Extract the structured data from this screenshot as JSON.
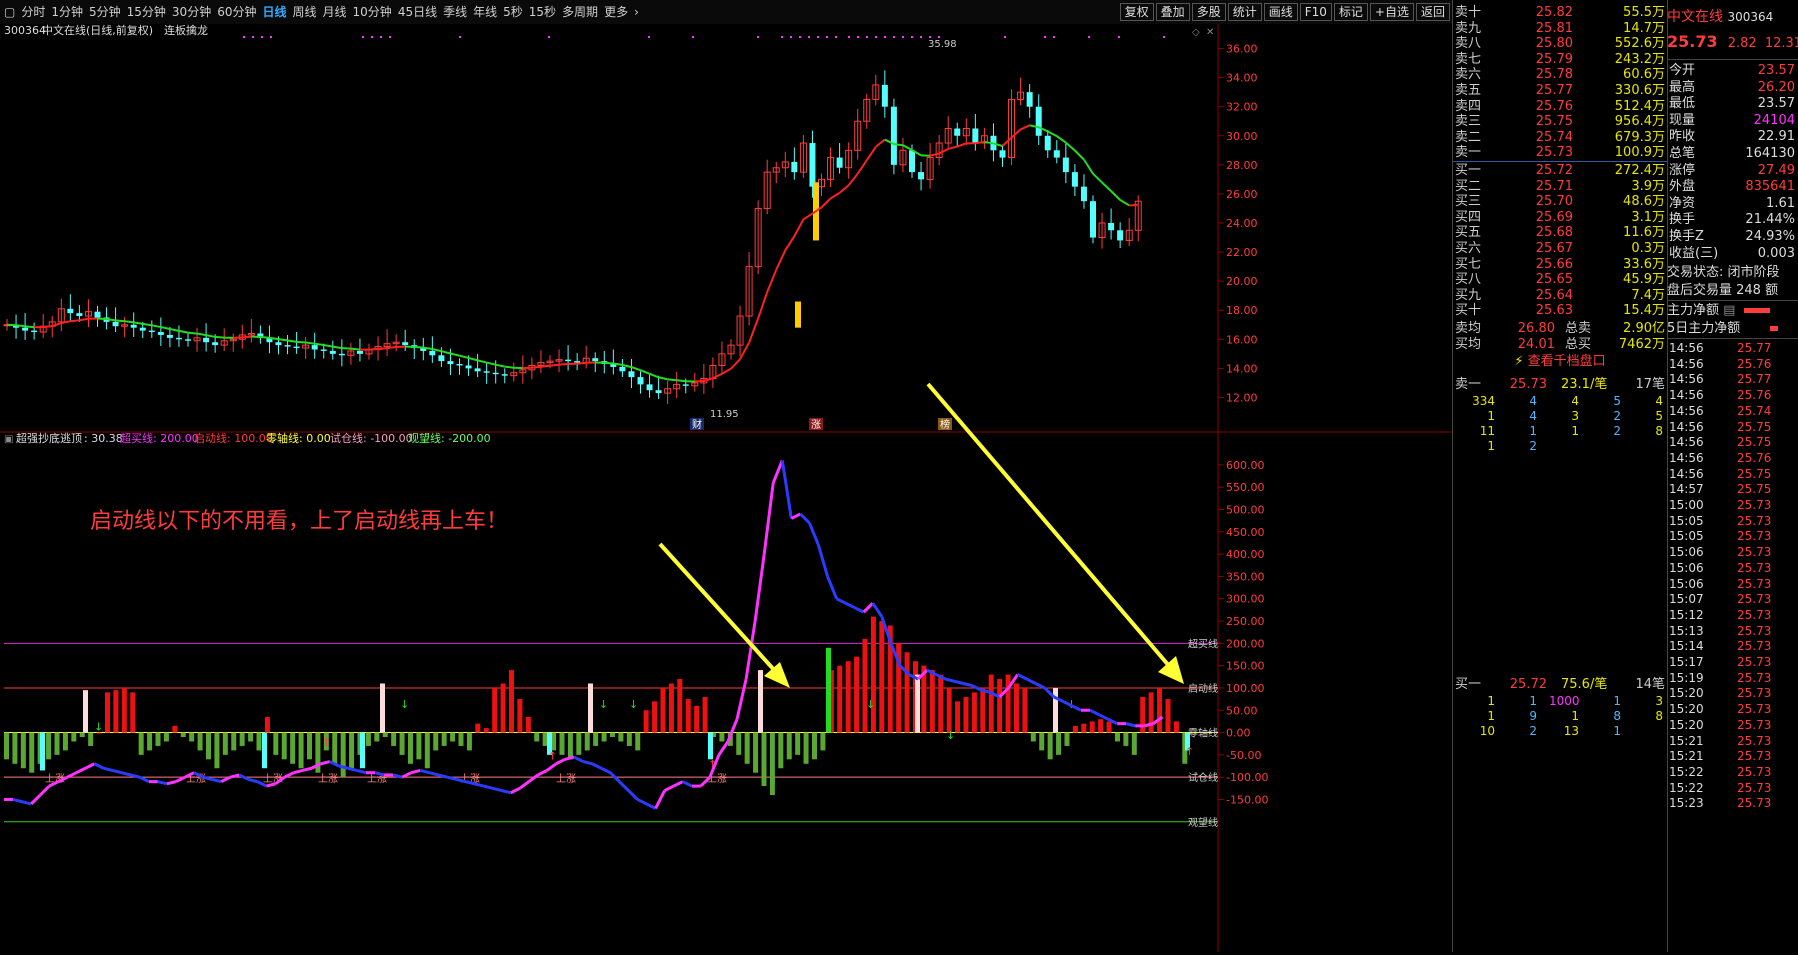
{
  "toolbar": {
    "periods": [
      "分时",
      "1分钟",
      "5分钟",
      "15分钟",
      "30分钟",
      "60分钟",
      "日线",
      "周线",
      "月线",
      "10分钟",
      "45日线",
      "季线",
      "年线",
      "5秒",
      "15秒",
      "多周期",
      "更多"
    ],
    "active_index": 6,
    "right_buttons": [
      "复权",
      "叠加",
      "多股",
      "统计",
      "画线",
      "F10",
      "标记",
      "+自选",
      "返回"
    ]
  },
  "chart_header": {
    "code": "300364",
    "name": "中文在线(日线,前复权)",
    "tag": "连板擒龙"
  },
  "price_axis": [
    "36.00",
    "34.00",
    "32.00",
    "30.00",
    "28.00",
    "26.00",
    "24.00",
    "22.00",
    "20.00",
    "18.00",
    "16.00",
    "14.00",
    "12.00"
  ],
  "price_labels": {
    "high": "35.98",
    "low": "11.95",
    "mark1": "财",
    "mark2": "涨",
    "mark3": "榜"
  },
  "indicator_header": {
    "name": "超强抄底逃顶",
    "value": ": 30.38",
    "chaomai": "超买线: 200.00",
    "qidong": "启动线: 100.00",
    "lingzhou": "零轴线: 0.00",
    "shicang": "试仓线: -100.00",
    "guanwang": "观望线: -200.00"
  },
  "indicator_axis": [
    "600.00",
    "550.00",
    "500.00",
    "450.00",
    "400.00",
    "350.00",
    "300.00",
    "250.00",
    "200.00",
    "150.00",
    "100.00",
    "50.00",
    "0.00",
    "-50.00",
    "-100.00",
    "-150.00"
  ],
  "indicator_lines": {
    "chaomai": "超买线",
    "qidong": "启动线",
    "lingzhou": "零轴线",
    "shicang": "试仓线",
    "guanwang": "观望线"
  },
  "annotation": "启动线以下的不用看，上了启动线再上车！",
  "bar_labels": [
    "上涨",
    "上涨",
    "上涨",
    "上涨",
    "上涨",
    "上涨",
    "上涨",
    "上涨"
  ],
  "sell_quotes": [
    {
      "label": "卖十",
      "price": "25.82",
      "vol": "55.5万"
    },
    {
      "label": "卖九",
      "price": "25.81",
      "vol": "14.7万"
    },
    {
      "label": "卖八",
      "price": "25.80",
      "vol": "552.6万"
    },
    {
      "label": "卖七",
      "price": "25.79",
      "vol": "243.2万"
    },
    {
      "label": "卖六",
      "price": "25.78",
      "vol": "60.6万"
    },
    {
      "label": "卖五",
      "price": "25.77",
      "vol": "330.6万"
    },
    {
      "label": "卖四",
      "price": "25.76",
      "vol": "512.4万"
    },
    {
      "label": "卖三",
      "price": "25.75",
      "vol": "956.4万"
    },
    {
      "label": "卖二",
      "price": "25.74",
      "vol": "679.3万"
    },
    {
      "label": "卖一",
      "price": "25.73",
      "vol": "100.9万"
    }
  ],
  "buy_quotes": [
    {
      "label": "买一",
      "price": "25.72",
      "vol": "272.4万"
    },
    {
      "label": "买二",
      "price": "25.71",
      "vol": "3.9万"
    },
    {
      "label": "买三",
      "price": "25.70",
      "vol": "48.6万"
    },
    {
      "label": "买四",
      "price": "25.69",
      "vol": "3.1万"
    },
    {
      "label": "买五",
      "price": "25.68",
      "vol": "11.6万"
    },
    {
      "label": "买六",
      "price": "25.67",
      "vol": "0.3万"
    },
    {
      "label": "买七",
      "price": "25.66",
      "vol": "33.6万"
    },
    {
      "label": "买八",
      "price": "25.65",
      "vol": "45.9万"
    },
    {
      "label": "买九",
      "price": "25.64",
      "vol": "7.4万"
    },
    {
      "label": "买十",
      "price": "25.63",
      "vol": "15.4万"
    }
  ],
  "averages": [
    {
      "label": "卖均",
      "price": "26.80",
      "k": "总卖",
      "v": "2.90亿"
    },
    {
      "label": "买均",
      "price": "24.01",
      "k": "总买",
      "v": "7462万"
    }
  ],
  "view_qiandang": "查看千档盘口",
  "sell1_queue": {
    "label": "卖一",
    "price": "25.73",
    "vol": "23.1/笔",
    "count": "17笔",
    "rows": [
      [
        "334",
        "4",
        "4",
        "5",
        "4"
      ],
      [
        "1",
        "4",
        "3",
        "2",
        "5"
      ],
      [
        "11",
        "1",
        "1",
        "2",
        "8"
      ],
      [
        "1",
        "2",
        "",
        "",
        ""
      ]
    ]
  },
  "buy1_queue": {
    "label": "买一",
    "price": "25.72",
    "vol": "75.6/笔",
    "count": "14笔",
    "rows": [
      [
        "1",
        "1",
        "1000",
        "1",
        "3"
      ],
      [
        "1",
        "9",
        "1",
        "8",
        "8"
      ],
      [
        "10",
        "2",
        "13",
        "1",
        ""
      ]
    ]
  },
  "stock": {
    "name": "中文在线",
    "code": "300364",
    "price": "25.73",
    "change": "2.82",
    "pct": "12.31"
  },
  "stats": [
    {
      "k": "今开",
      "v": "23.57"
    },
    {
      "k": "最高",
      "v": "26.20"
    },
    {
      "k": "最低",
      "v": "23.57"
    },
    {
      "k": "现量",
      "v": "24104"
    },
    {
      "k": "昨收",
      "v": "22.91"
    },
    {
      "k": "总笔",
      "v": "164130"
    },
    {
      "k": "涨停",
      "v": "27.49"
    },
    {
      "k": "外盘",
      "v": "835641"
    },
    {
      "k": "净资",
      "v": "1.61"
    },
    {
      "k": "换手",
      "v": "21.44%"
    },
    {
      "k": "换手Z",
      "v": "24.93%"
    },
    {
      "k": "收益(三)",
      "v": "0.003"
    }
  ],
  "trade_state": "交易状态: 闭市阶段",
  "auction_vol": "盘后交易量 248 额",
  "main_flow": "主力净额",
  "main_flow5": "5日主力净额",
  "ticks": [
    [
      "14:56",
      "25.77"
    ],
    [
      "14:56",
      "25.76"
    ],
    [
      "14:56",
      "25.77"
    ],
    [
      "14:56",
      "25.76"
    ],
    [
      "14:56",
      "25.74"
    ],
    [
      "14:56",
      "25.75"
    ],
    [
      "14:56",
      "25.75"
    ],
    [
      "14:56",
      "25.76"
    ],
    [
      "14:56",
      "25.75"
    ],
    [
      "14:57",
      "25.75"
    ],
    [
      "15:00",
      "25.73"
    ],
    [
      "15:05",
      "25.73"
    ],
    [
      "15:05",
      "25.73"
    ],
    [
      "15:06",
      "25.73"
    ],
    [
      "15:06",
      "25.73"
    ],
    [
      "15:06",
      "25.73"
    ],
    [
      "15:07",
      "25.73"
    ],
    [
      "15:12",
      "25.73"
    ],
    [
      "15:13",
      "25.73"
    ],
    [
      "15:14",
      "25.73"
    ],
    [
      "15:17",
      "25.73"
    ],
    [
      "15:19",
      "25.73"
    ],
    [
      "15:20",
      "25.73"
    ],
    [
      "15:20",
      "25.73"
    ],
    [
      "15:20",
      "25.73"
    ],
    [
      "15:21",
      "25.73"
    ],
    [
      "15:21",
      "25.73"
    ],
    [
      "15:22",
      "25.73"
    ],
    [
      "15:22",
      "25.73"
    ],
    [
      "15:23",
      "25.73"
    ]
  ],
  "colors": {
    "up": "#ff3c3c",
    "down": "#54ffff",
    "ma_up": "#ff2020",
    "ma_down": "#22dd22",
    "indicator_up": "#ff33ff",
    "indicator_down": "#2a3cff",
    "arrow": "#ffff33"
  }
}
